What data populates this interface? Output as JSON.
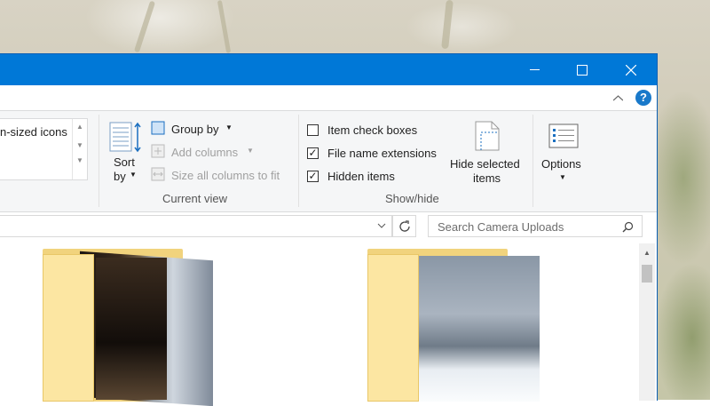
{
  "window": {
    "minimize_icon": "minimize-icon",
    "maximize_icon": "maximize-icon",
    "close_icon": "close-icon",
    "accent": "#0078d7"
  },
  "ribbon": {
    "layout_partial_label": "n-sized icons",
    "current_view": {
      "sort_by_label": "Sort by",
      "sort_by_line1": "Sort",
      "sort_by_line2": "by",
      "group_by": "Group by",
      "add_columns": "Add columns",
      "size_all_columns": "Size all columns to fit",
      "group_label": "Current view"
    },
    "show_hide": {
      "item_check_boxes": "Item check boxes",
      "item_check_boxes_checked": false,
      "file_name_extensions": "File name extensions",
      "file_name_extensions_checked": true,
      "hidden_items": "Hidden items",
      "hidden_items_checked": true,
      "hide_selected_line1": "Hide selected",
      "hide_selected_line2": "items",
      "group_label": "Show/hide"
    },
    "options_label": "Options"
  },
  "address": {
    "search_placeholder": "Search Camera Uploads"
  }
}
